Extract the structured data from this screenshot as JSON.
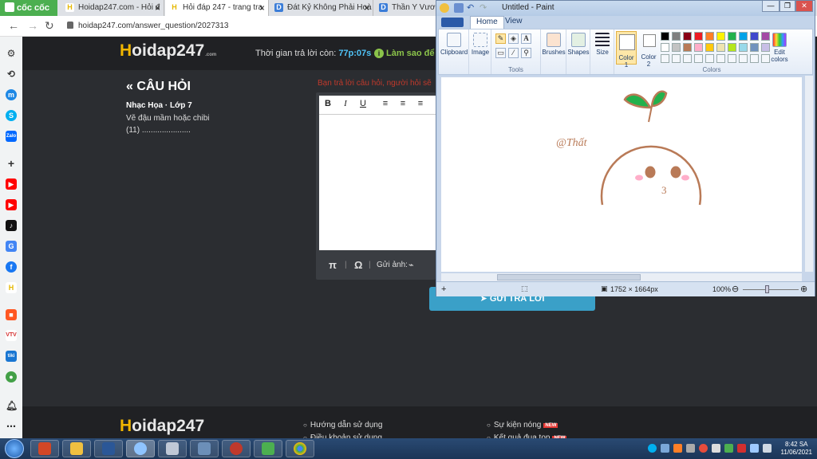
{
  "browser": {
    "brand": "cốc cốc",
    "tabs": [
      {
        "label": "Hoidap247.com - Hỏi đ",
        "icon": "H"
      },
      {
        "label": "Hỏi đáp 247 - trang tra",
        "icon": "H"
      },
      {
        "label": "Đát Kỷ Không Phải Hoà",
        "icon": "D"
      },
      {
        "label": "Thần Y Vương",
        "icon": "D"
      }
    ],
    "url": "hoidap247.com/answer_question/2027313"
  },
  "site": {
    "logo_h": "H",
    "logo_rest": "oidap247",
    "logo_com": ".com",
    "timer_label": "Thời gian trả lời còn:",
    "timer_value": "77p:07s",
    "howto_label": "Làm sao để c",
    "howto_icon": "i"
  },
  "question": {
    "header": "« CÂU HỎI",
    "subject": "Nhạc Họa · Lớp 7",
    "body": "Vẽ đậu mầm hoặc chibi",
    "points": "(11) ......................"
  },
  "answer": {
    "warning": "Bạn trả lời câu hỏi, người hỏi sẽ",
    "toolbar": {
      "bold": "B",
      "italic": "I",
      "underline": "U"
    },
    "footer": {
      "pi": "π",
      "omega": "Ω",
      "attach_label": "Gửi ảnh:"
    },
    "submit_label": "GỬI TRẢ LỜI"
  },
  "footer": {
    "links": [
      "Hướng dẫn sử dụng",
      "Điều khoản sử dụng",
      "Sự kiện nóng",
      "Kết quả đua top"
    ],
    "new_badge": "NEW"
  },
  "paint": {
    "title": "Untitled - Paint",
    "tabs": [
      "Home",
      "View"
    ],
    "groups": {
      "clipboard": "Clipboard",
      "image": "Image",
      "tools": "Tools",
      "brushes": "Brushes",
      "shapes": "Shapes",
      "size": "Size",
      "color1": "Color 1",
      "color2": "Color 2",
      "edit_colors": "Edit colors",
      "colors": "Colors"
    },
    "palette": [
      "#000000",
      "#7f7f7f",
      "#880015",
      "#ed1c24",
      "#ff7f27",
      "#fff200",
      "#22b14c",
      "#00a2e8",
      "#3f48cc",
      "#a349a4",
      "#ffffff",
      "#c3c3c3",
      "#b97a57",
      "#ffaec9",
      "#ffc90e",
      "#efe4b0",
      "#b5e61d",
      "#99d9ea",
      "#7092be",
      "#c8bfe7"
    ],
    "drawing": {
      "signature": "@Thất",
      "mouth": "3",
      "line_color": "#b97a57",
      "leaf_color": "#22b14c",
      "blush_color": "#ffaec9"
    },
    "status": {
      "dimensions": "1752 × 1664px",
      "zoom": "100%"
    }
  },
  "taskbar": {
    "clock_time": "8:42 SA",
    "clock_date": "11/06/2021"
  }
}
